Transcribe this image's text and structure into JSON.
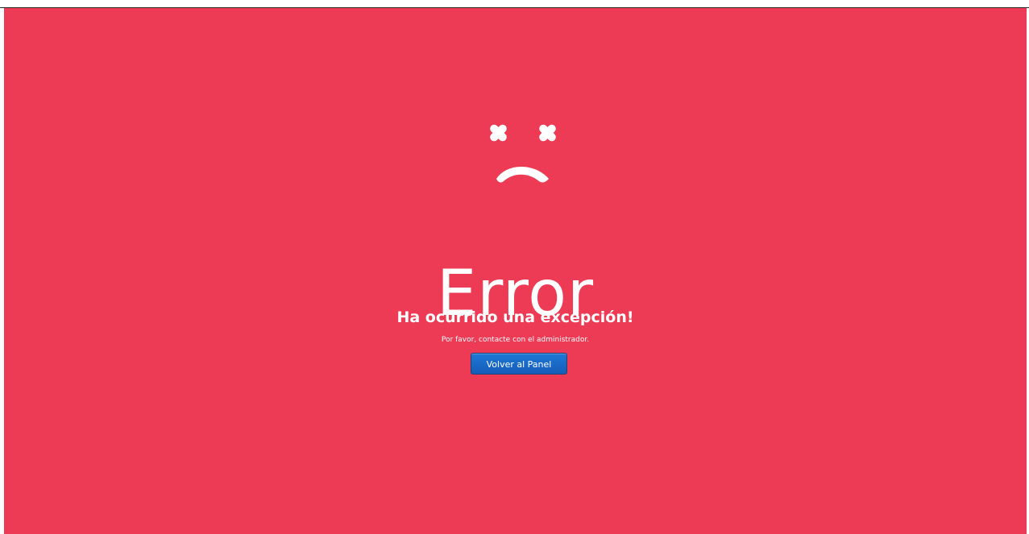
{
  "page": {
    "background_color": "#ee3b55",
    "icon": "sad-face-icon",
    "title": "Error",
    "subtitle": "Ha ocurrido una excepción!",
    "message": "Por favor, contacte con el administrador.",
    "button": {
      "label": "Volver al Panel",
      "color": "#1a6acb"
    }
  }
}
